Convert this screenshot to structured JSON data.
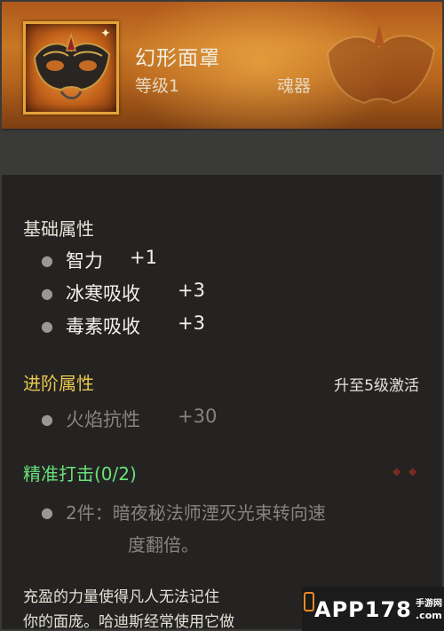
{
  "item": {
    "name": "幻形面罩",
    "level": "等级1",
    "slot": "魂器"
  },
  "base_attributes": {
    "title": "基础属性",
    "stats": [
      {
        "name": "智力",
        "value": "+1"
      },
      {
        "name": "冰寒吸收",
        "value": "+3"
      },
      {
        "name": "毒素吸收",
        "value": "+3"
      }
    ]
  },
  "advanced_attributes": {
    "title": "进阶属性",
    "unlock_hint": "升至5级激活",
    "stats": [
      {
        "name": "火焰抗性",
        "value": "+30"
      }
    ]
  },
  "set_bonus": {
    "title": "精准打击(0/2)",
    "line1": "2件：暗夜秘法师湮灭光束转向速",
    "line2": "度翻倍。"
  },
  "lore": {
    "line1": "充盈的力量使得凡人无法记住",
    "line2": "你的面庞。哈迪斯经常使用它做"
  },
  "watermark": {
    "text": "APP178",
    "sub": "手游网",
    "domain": ".com"
  },
  "colors": {
    "header": "#c77725",
    "gold_title": "#e8c64f",
    "set_green": "#69e07a",
    "dim_text": "#87847f"
  }
}
